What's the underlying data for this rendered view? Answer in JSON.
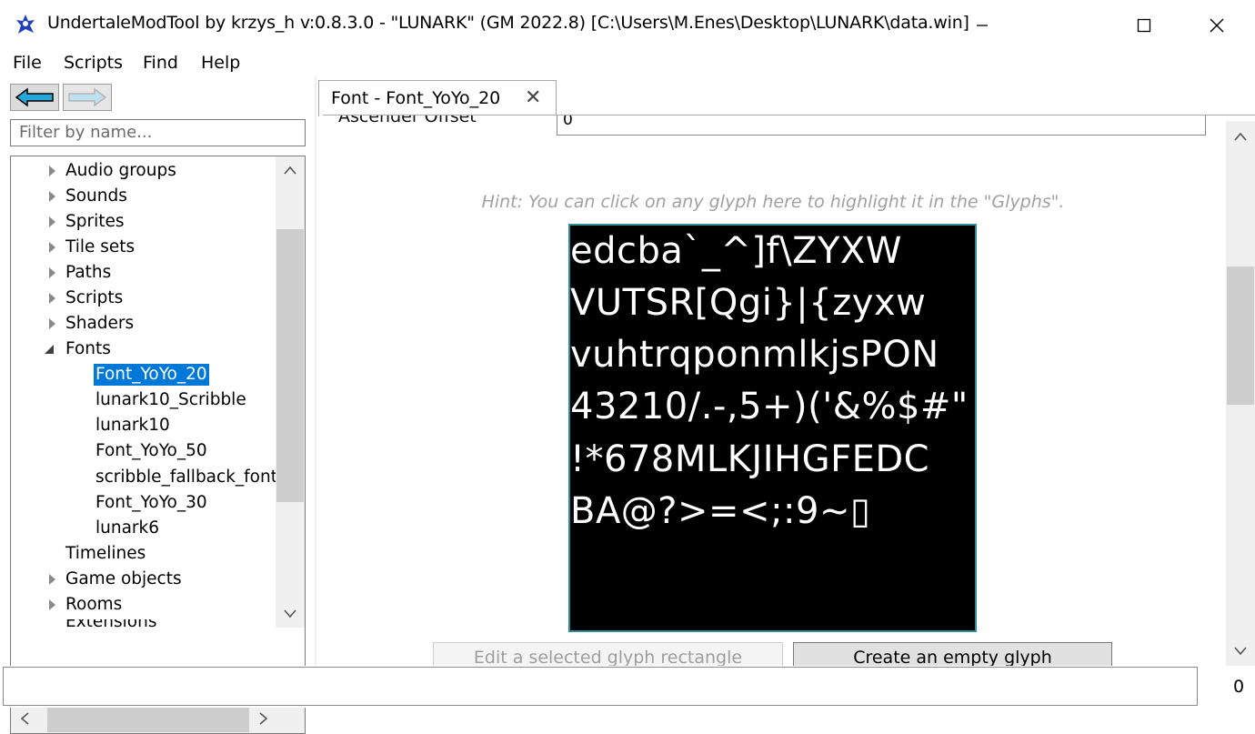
{
  "window": {
    "title": "UndertaleModTool by krzys_h v:0.8.3.0 - \"LUNARK\" (GM 2022.8) [C:\\Users\\M.Enes\\Desktop\\LUNARK\\data.win]"
  },
  "menu": {
    "file": "File",
    "scripts": "Scripts",
    "find": "Find",
    "help": "Help"
  },
  "filter": {
    "placeholder": "Filter by name..."
  },
  "tree": {
    "audio_groups": "Audio groups",
    "sounds": "Sounds",
    "sprites": "Sprites",
    "tile_sets": "Tile sets",
    "paths": "Paths",
    "scripts": "Scripts",
    "shaders": "Shaders",
    "fonts": "Fonts",
    "font_items": [
      "Font_YoYo_20",
      "lunark10_Scribble",
      "lunark10",
      "Font_YoYo_50",
      "scribble_fallback_font",
      "Font_YoYo_30",
      "lunark6"
    ],
    "timelines": "Timelines",
    "game_objects": "Game objects",
    "rooms": "Rooms",
    "extensions_partial": "Extensions"
  },
  "tab": {
    "label": "Font - Font_YoYo_20",
    "close": "✕"
  },
  "editor": {
    "ascender_label": "Ascender Offset",
    "ascender_value": "0",
    "hint": "Hint: You can click on any glyph here to highlight it in the \"Glyphs\".",
    "glyph_lines": [
      " edcba`_^]f\\ZYXW",
      "VUTSR[Qgi}|{zyxw",
      "vuhtrqponmlkjsPON",
      "43210/.-,5+)('&%$#\"",
      "!*678MLKJIHGFEDC",
      "BA@?>=<;:9~▯"
    ],
    "edit_button": "Edit a selected glyph rectangle",
    "create_button": "Create an empty glyph"
  },
  "status": {
    "value": "0"
  },
  "colors": {
    "selection": "#0078d7",
    "glyph_border": "#2f8f9a",
    "hint": "#a0a0a0"
  }
}
